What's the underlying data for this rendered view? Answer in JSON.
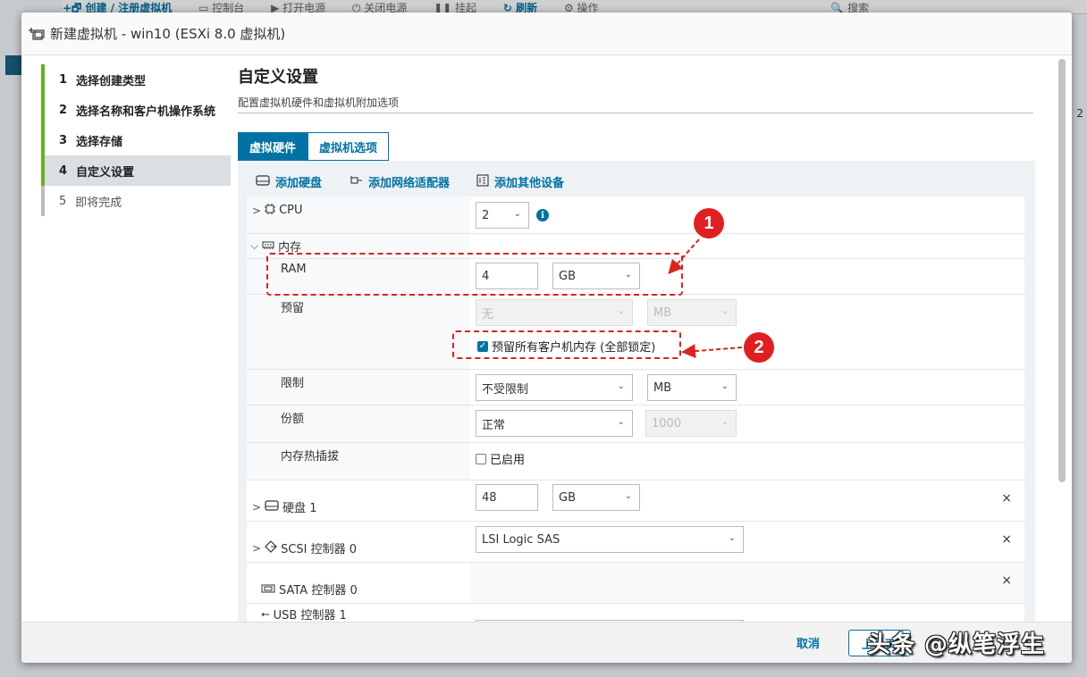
{
  "background": {
    "toolbar_items": [
      "+🗗 创建 / 注册虚拟机",
      "▭ 控制台",
      "▶ 打开电源",
      "⏻ 关闭电源",
      "❚❚ 挂起",
      "↻ 刷新",
      "⚙ 操作",
      "🔍 搜索"
    ],
    "right_number": "2"
  },
  "modal": {
    "title": "新建虚拟机 - win10 (ESXi 8.0 虚拟机)"
  },
  "steps": [
    {
      "num": "1",
      "label": "选择创建类型"
    },
    {
      "num": "2",
      "label": "选择名称和客户机操作系统"
    },
    {
      "num": "3",
      "label": "选择存储"
    },
    {
      "num": "4",
      "label": "自定义设置"
    },
    {
      "num": "5",
      "label": "即将完成"
    }
  ],
  "page": {
    "title": "自定义设置",
    "subtitle": "配置虚拟机硬件和虚拟机附加选项"
  },
  "tabs": [
    "虚拟硬件",
    "虚拟机选项"
  ],
  "actions": {
    "add_disk": "添加硬盘",
    "add_nic": "添加网络适配器",
    "add_other": "添加其他设备"
  },
  "hardware": {
    "cpu": {
      "label": "CPU",
      "value": "2"
    },
    "memory": {
      "label": "内存"
    },
    "ram": {
      "label": "RAM",
      "value": "4",
      "unit": "GB"
    },
    "reservation": {
      "label": "预留",
      "value": "无",
      "unit": "MB",
      "checkbox_label": "预留所有客户机内存 (全部锁定)",
      "checked": true
    },
    "limit": {
      "label": "限制",
      "value": "不受限制",
      "unit": "MB"
    },
    "shares": {
      "label": "份额",
      "value": "正常",
      "number": "1000"
    },
    "hotplug": {
      "label": "内存热插拔",
      "checkbox_label": "已启用",
      "checked": false
    },
    "disk1": {
      "label": "硬盘 1",
      "value": "48",
      "unit": "GB"
    },
    "scsi": {
      "label": "SCSI 控制器 0",
      "value": "LSI Logic SAS"
    },
    "sata": {
      "label": "SATA 控制器 0"
    },
    "usb": {
      "label": "USB 控制器 1"
    },
    "remove_symbol": "×"
  },
  "annotations": {
    "badge1": "1",
    "badge2": "2",
    "color": "#e02020"
  },
  "footer": {
    "cancel": "取消",
    "prev": "上一页"
  },
  "watermark": "头条 @纵笔浮生",
  "colors": {
    "accent": "#0072a3",
    "step_done": "#60b515",
    "annotation": "#e02020"
  }
}
